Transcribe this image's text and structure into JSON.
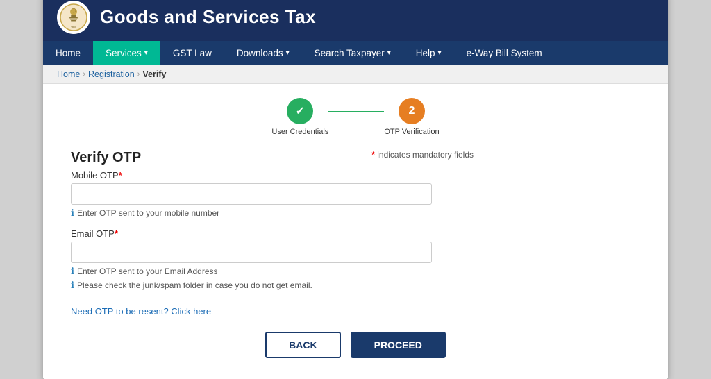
{
  "header": {
    "title": "Goods and Services Tax"
  },
  "navbar": {
    "items": [
      {
        "id": "home",
        "label": "Home",
        "active": false,
        "has_dropdown": false
      },
      {
        "id": "services",
        "label": "Services",
        "active": true,
        "has_dropdown": true
      },
      {
        "id": "gst-law",
        "label": "GST Law",
        "active": false,
        "has_dropdown": false
      },
      {
        "id": "downloads",
        "label": "Downloads",
        "active": false,
        "has_dropdown": true
      },
      {
        "id": "search-taxpayer",
        "label": "Search Taxpayer",
        "active": false,
        "has_dropdown": true
      },
      {
        "id": "help",
        "label": "Help",
        "active": false,
        "has_dropdown": true
      },
      {
        "id": "eway-bill",
        "label": "e-Way Bill System",
        "active": false,
        "has_dropdown": false
      }
    ]
  },
  "breadcrumb": {
    "home": "Home",
    "registration": "Registration",
    "current": "Verify"
  },
  "steps": [
    {
      "id": "user-credentials",
      "label": "User Credentials",
      "state": "completed",
      "icon": "✓"
    },
    {
      "id": "otp-verification",
      "label": "OTP Verification",
      "state": "active",
      "icon": "2"
    }
  ],
  "form": {
    "title": "Verify OTP",
    "mandatory_note": "* indicates mandatory fields",
    "mobile_otp_label": "Mobile OTP",
    "mobile_otp_hint": "Enter OTP sent to your mobile number",
    "email_otp_label": "Email OTP",
    "email_otp_hint1": "Enter OTP sent to your Email Address",
    "email_otp_hint2": "Please check the junk/spam folder in case you do not get email.",
    "resend_link": "Need OTP to be resent? Click here"
  },
  "buttons": {
    "back": "BACK",
    "proceed": "PROCEED"
  }
}
